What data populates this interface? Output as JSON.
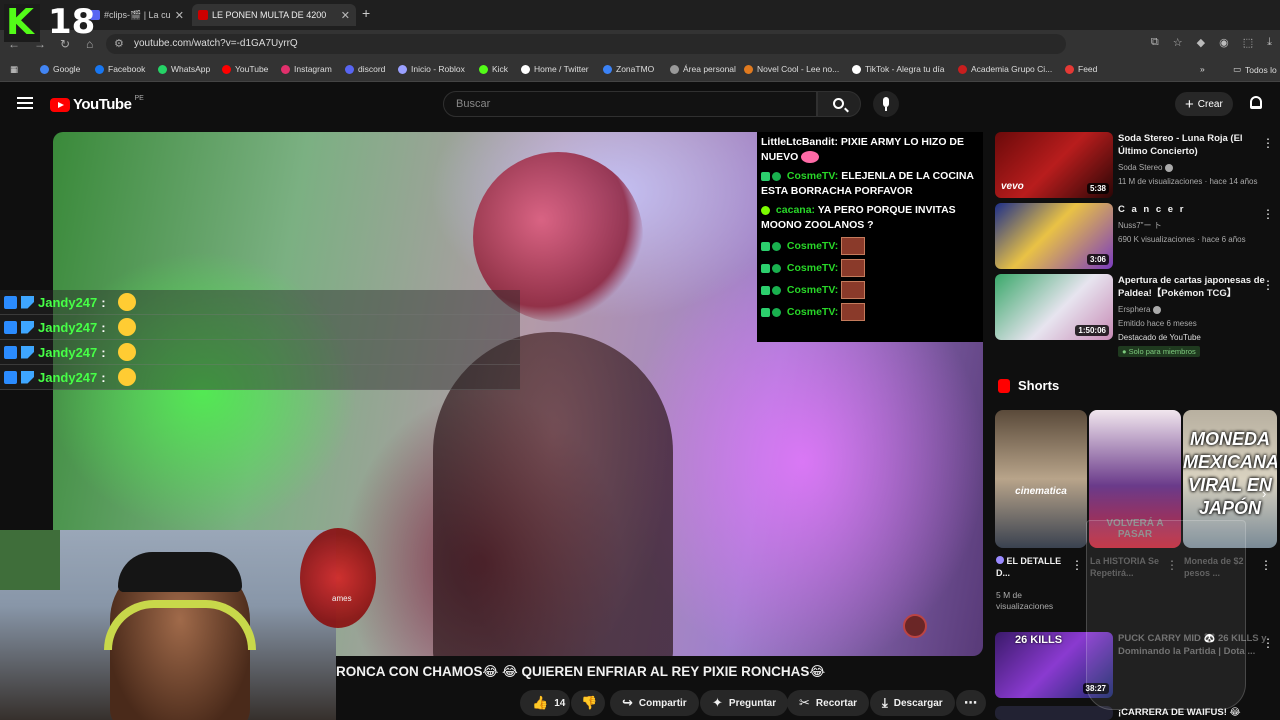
{
  "browser": {
    "overlay_age": "18",
    "tabs": [
      {
        "label": "#clips-🎬 | La cu"
      },
      {
        "label": "LE PONEN MULTA DE 4200"
      }
    ],
    "url": "youtube.com/watch?v=-d1GA7UyrrQ",
    "bookmarks": [
      {
        "label": "Google",
        "color": "#4285f4"
      },
      {
        "label": "Facebook",
        "color": "#1877f2"
      },
      {
        "label": "WhatsApp",
        "color": "#25d366"
      },
      {
        "label": "YouTube",
        "color": "#ff0000"
      },
      {
        "label": "Instagram",
        "color": "#e1306c"
      },
      {
        "label": "discord",
        "color": "#5865f2"
      },
      {
        "label": "Inicio - Roblox",
        "color": "#9aa0ff"
      },
      {
        "label": "Kick",
        "color": "#53fc18"
      },
      {
        "label": "Home / Twitter",
        "color": "#ffffff"
      },
      {
        "label": "ZonaTMO",
        "color": "#3b82f6"
      },
      {
        "label": "Área personal",
        "color": "#999999"
      },
      {
        "label": "Novel Cool - Lee no...",
        "color": "#e07a1f"
      },
      {
        "label": "TikTok - Alegra tu día",
        "color": "#ffffff"
      },
      {
        "label": "Academia Grupo Ci...",
        "color": "#c81e1e"
      },
      {
        "label": "Feed",
        "color": "#e53935"
      }
    ],
    "all_bookmarks": "Todos lo"
  },
  "youtube": {
    "logo": "YouTube",
    "region": "PE",
    "search_placeholder": "Buscar",
    "create_label": "Crear"
  },
  "chat_overlay": [
    {
      "user": "LittleLtcBandit:",
      "text": "PIXIE ARMY LO HIZO DE NUEVO",
      "user_color": "white"
    },
    {
      "user": "CosmeTV:",
      "text": "ELEJENLA DE LA COCINA ESTA BORRACHA PORFAVOR",
      "user_color": "green"
    },
    {
      "user": "cacana:",
      "text": "YA PERO PORQUE INVITAS MOONO ZOOLANOS ?",
      "user_color": "green"
    },
    {
      "user": "CosmeTV:",
      "text": "",
      "user_color": "green"
    },
    {
      "user": "CosmeTV:",
      "text": "",
      "user_color": "green"
    },
    {
      "user": "CosmeTV:",
      "text": "",
      "user_color": "green"
    },
    {
      "user": "CosmeTV:",
      "text": "",
      "user_color": "green"
    }
  ],
  "left_chat": [
    {
      "user": "Jandy247",
      "sep": ":"
    },
    {
      "user": "Jandy247",
      "sep": ":"
    },
    {
      "user": "Jandy247",
      "sep": ":"
    },
    {
      "user": "Jandy247",
      "sep": ":"
    }
  ],
  "overlay_brand": "ames",
  "video": {
    "title": "RONCA CON CHAMOS😂 😂 QUIEREN ENFRIAR AL REY PIXIE RONCHAS😂",
    "likes": "14",
    "share": "Compartir",
    "ask": "Preguntar",
    "clip": "Recortar",
    "download": "Descargar"
  },
  "recommendations": [
    {
      "title": "Soda Stereo - Luna Roja (El Último Concierto)",
      "channel": "Soda Stereo",
      "views": "11 M de visualizaciones · hace 14 años",
      "duration": "5:38",
      "thumb_label": "vevo"
    },
    {
      "title": "C a n c e r",
      "channel": "Nuss7\"ー ト",
      "views": "690 K visualizaciones · hace 6 años",
      "duration": "3:06"
    },
    {
      "title": "Apertura de cartas japonesas de Paldea!【Pokémon TCG】",
      "channel": "Ersphera",
      "views": "Emitido hace 6 meses",
      "extra": "Destacado de YouTube",
      "badge": "Solo para miembros",
      "duration": "1:50:06"
    }
  ],
  "shorts": {
    "heading": "Shorts",
    "items": [
      {
        "caption": "cinematica",
        "title": "EL DETALLE D...",
        "views": "5 M de visualizaciones"
      },
      {
        "caption": "VOLVERÁ A PASAR",
        "title": "La HISTORIA Se Repetirá...",
        "views": ""
      },
      {
        "caption": "MONEDA MEXICANA VIRAL EN JAPÓN",
        "title": "Moneda de $2 pesos ...",
        "views": ""
      }
    ]
  },
  "bottom_recs": [
    {
      "title": "PUCK CARRY MID 🐼 26 KILLS y Dominando la Partida | Dota ...",
      "thumb_label": "26 KILLS",
      "duration": "38:27"
    },
    {
      "title": "¡CARRERA DE WAIFUS! 😂"
    }
  ]
}
